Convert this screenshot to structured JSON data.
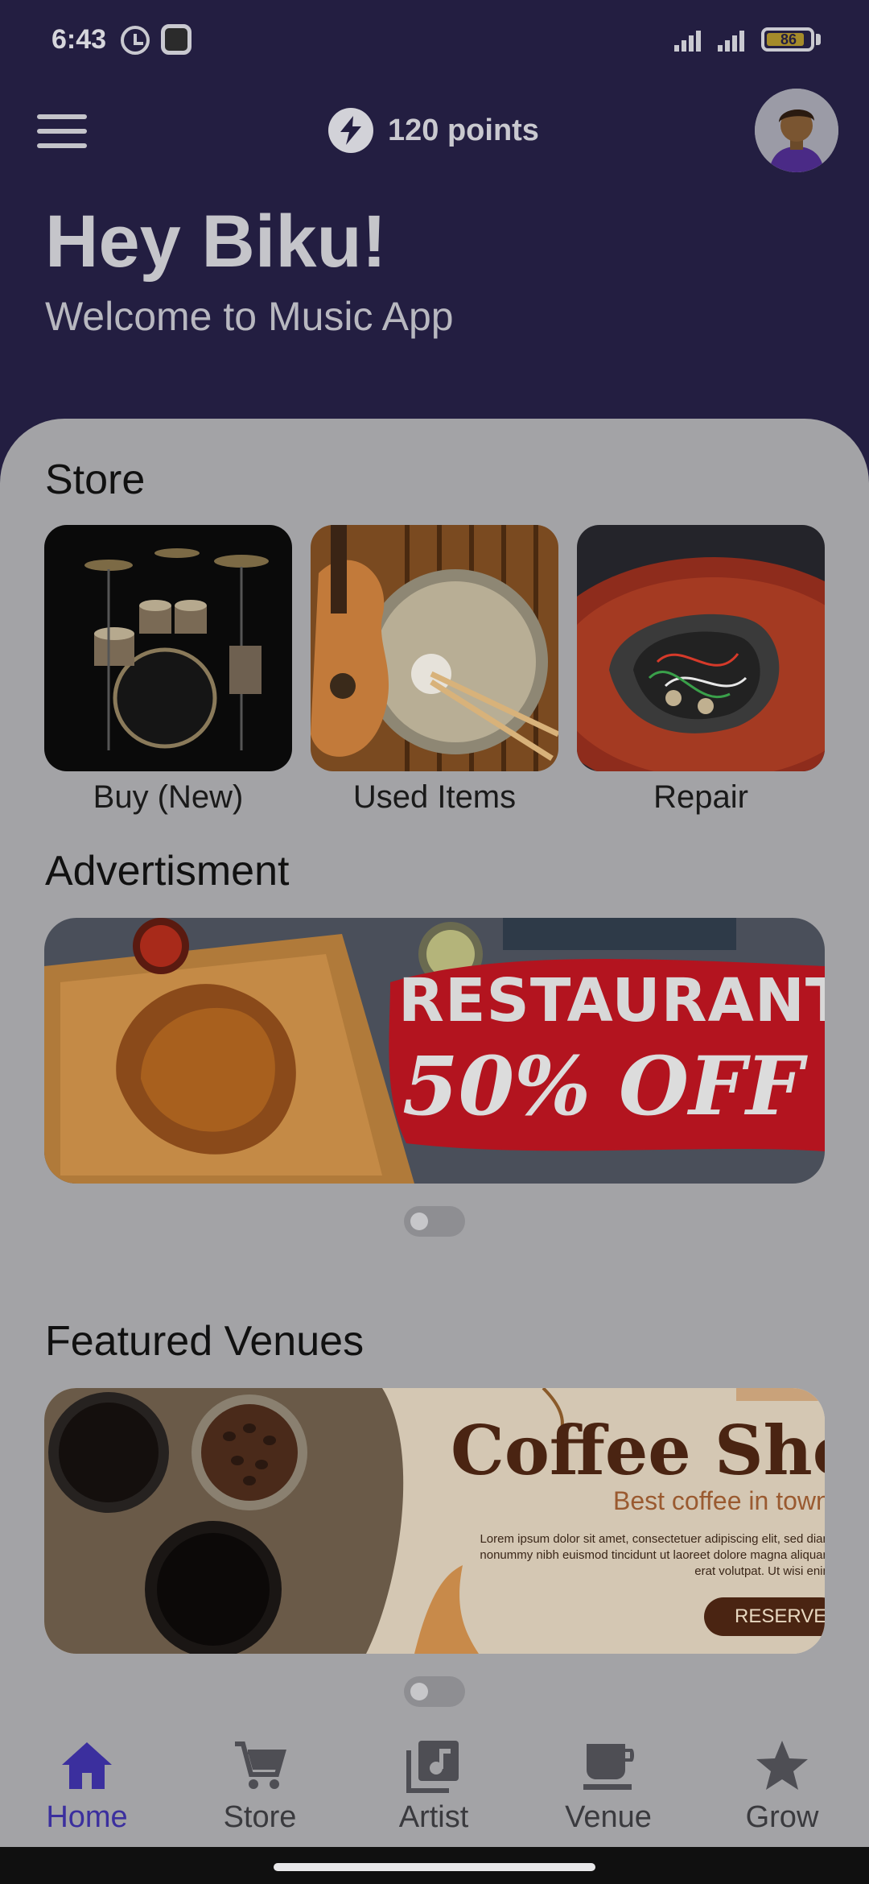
{
  "status_bar": {
    "time": "6:43",
    "battery": "86",
    "icons": [
      "alarm-icon",
      "app-status-icon",
      "signal-icon",
      "signal-icon",
      "battery-icon"
    ]
  },
  "header": {
    "menu_icon": "menu-icon",
    "points_icon": "bolt-icon",
    "points_label": "120 points",
    "greeting": "Hey Biku!",
    "subtitle": "Welcome to Music App"
  },
  "store": {
    "title": "Store",
    "items": [
      {
        "label": "Buy (New)",
        "image": "drum-kit"
      },
      {
        "label": "Used Items",
        "image": "guitar-and-drum"
      },
      {
        "label": "Repair",
        "image": "guitar-electronics"
      }
    ]
  },
  "advertisement": {
    "title": "Advertisment",
    "banner_line1": "RESTAURANT",
    "banner_line2": "50% OFF"
  },
  "featured_venues": {
    "title": "Featured Venues",
    "banner_title": "Coffee Shop",
    "banner_subtitle": "Best coffee in town",
    "banner_body": "Lorem ipsum dolor sit amet, consectetuer adipiscing elit, sed diam nonummy nibh euismod tincidunt ut laoreet dolore magna aliquam erat volutpat. Ut wisi enim",
    "banner_button": "RESERVE"
  },
  "bottom_nav": {
    "items": [
      {
        "label": "Home",
        "icon": "home-icon",
        "active": true
      },
      {
        "label": "Store",
        "icon": "cart-icon",
        "active": false
      },
      {
        "label": "Artist",
        "icon": "music-library-icon",
        "active": false
      },
      {
        "label": "Venue",
        "icon": "coffee-cup-icon",
        "active": false
      },
      {
        "label": "Grow",
        "icon": "star-icon",
        "active": false
      }
    ]
  },
  "colors": {
    "header_bg": "#231e41",
    "card_bg": "#a3a3a6",
    "accent": "#3b2f9e",
    "banner_red": "#b3141f"
  }
}
